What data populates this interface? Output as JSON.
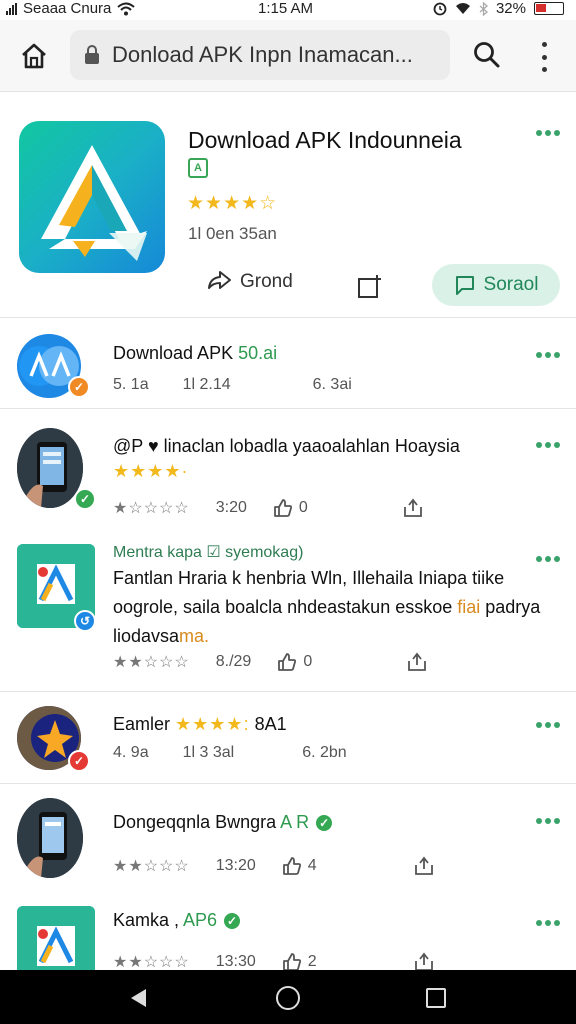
{
  "status_bar": {
    "carrier": "Seaaa Cnura",
    "time": "1:15 AM",
    "battery": "32%"
  },
  "browser": {
    "url_text": "Donload APK Inpn Inamacan..."
  },
  "featured": {
    "title": "Download APK Indounneia",
    "badge": "A",
    "stars": "★★★★☆",
    "meta": "1l 0en 35an",
    "share_label": "Grond",
    "primary_label": "Soraol"
  },
  "items": [
    {
      "title_main": "Download APK ",
      "title_accent": "50.ai",
      "meta": [
        "5. 1a",
        "1l 2.14",
        "6. 3ai"
      ]
    },
    {
      "title": "@P ♥ linaclan lobadla yaaoalahlan Hoaysia",
      "rating_stars": "★★★★·",
      "stars": "★☆☆☆☆",
      "time": "3:20",
      "likes": "0"
    },
    {
      "title": "Mentra kapa ☑ syemokag)",
      "desc_main": "Fantlan Hraria k henbria Wln, Illehaila Iniapa tiike oogrole, saila boalcla nhdeastakun esskoe ",
      "desc_accent1": "fiai",
      "desc_tail": " padrya liodavsa",
      "desc_accent2": "ma.",
      "stars": "★★☆☆☆",
      "time": "8./29",
      "likes": "0"
    },
    {
      "title_main": "Eamler ",
      "title_stars": "★★★★:",
      "title_tail": " 8A1",
      "meta": [
        "4. 9a",
        "1l 3 3al",
        "6. 2bn"
      ]
    },
    {
      "title_main": "Dongeqqnla Bwngra ",
      "title_accent": "A R",
      "stars": "★★☆☆☆",
      "time": "13:20",
      "likes": "4"
    },
    {
      "title_main": "Kamka , ",
      "title_accent": "AP6",
      "stars": "★★☆☆☆",
      "time": "13:30",
      "likes": "2"
    }
  ],
  "colors": {
    "accent_green": "#2e9a4f",
    "star_gold": "#f2b81c",
    "primary_bg": "#d9f1e6"
  },
  "icons": [
    "home-icon",
    "lock-icon",
    "search-icon",
    "overflow-menu-icon",
    "share-icon",
    "save-icon",
    "chat-icon",
    "thumb-up-icon",
    "share-out-icon",
    "back-icon",
    "home-nav-icon",
    "recents-icon"
  ]
}
